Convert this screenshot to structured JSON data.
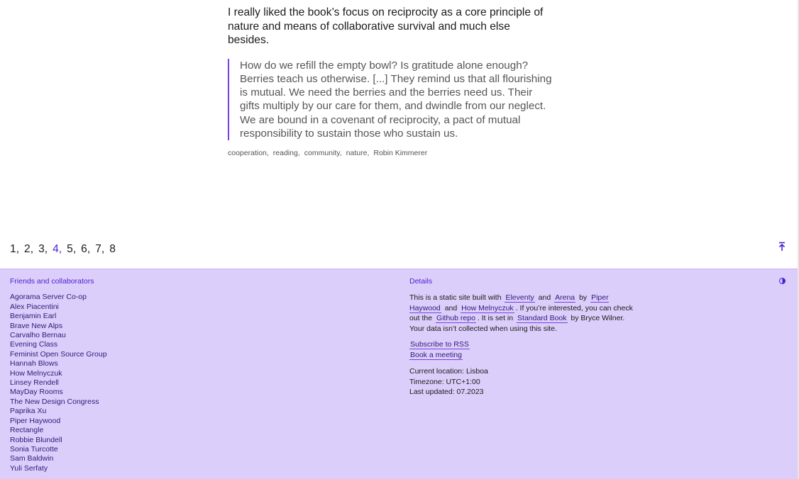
{
  "article": {
    "lead": "I really liked the book’s focus on reciprocity as a core principle of nature and means of collaborative survival and much else besides.",
    "quote": "How do we refill the empty bowl? Is gratitude alone enough? Berries teach us otherwise. [...] They remind us that all flourishing is mutual. We need the berries and the berries need us. Their gifts multiply by our care for them, and dwindle from our neglect. We are bound in a covenant of reciprocity, a pact of mutual responsibility to sustain those who sustain us.",
    "tags": [
      "cooperation",
      "reading",
      "community",
      "nature",
      "Robin Kimmerer"
    ]
  },
  "pagination": {
    "pages": [
      "1",
      "2",
      "3",
      "4",
      "5",
      "6",
      "7",
      "8"
    ],
    "current": "4"
  },
  "icons": {
    "to_top": "arrow-up-to-top-icon",
    "theme": "half-circle-contrast-icon"
  },
  "colors": {
    "accent": "#4b1fd1",
    "footer_bg": "#dccefa",
    "quote_border": "#7b3fe4"
  },
  "footer": {
    "friends": {
      "heading": "Friends and collaborators",
      "items": [
        "Agorama Server Co-op",
        "Alex Piacentini",
        "Benjamin Earl",
        "Brave New Alps",
        "Carvalho Bernau",
        "Evening Class",
        "Feminist Open Source Group",
        "Hannah Blows",
        "How Melnyczuk",
        "Linsey Rendell",
        "MayDay Rooms",
        "The New Design Congress",
        "Paprika Xu",
        "Piper Haywood",
        "Rectangle",
        "Robbie Blundell",
        "Sonia Turcotte",
        "Sam Baldwin",
        "Yuli Serfaty"
      ]
    },
    "details": {
      "heading": "Details",
      "t1": "This is a static site built with",
      "link_eleventy": "Eleventy",
      "t2": "and",
      "link_arena": "Arena",
      "t3": "by",
      "link_piper": "Piper Haywood",
      "t4": "and",
      "link_how": "How Melnyczuk",
      "t5": ". If you’re interested, you can check out the",
      "link_github": "Github repo",
      "t6": ". It is set in",
      "link_standard": "Standard Book",
      "t7": "by Bryce Wilner. Your data isn’t collected when using this site.",
      "subscribe": "Subscribe to RSS",
      "book_meeting": "Book a meeting",
      "location": "Current location: Lisboa",
      "timezone": "Timezone: UTC+1:00",
      "updated": "Last updated: 07.2023"
    }
  }
}
